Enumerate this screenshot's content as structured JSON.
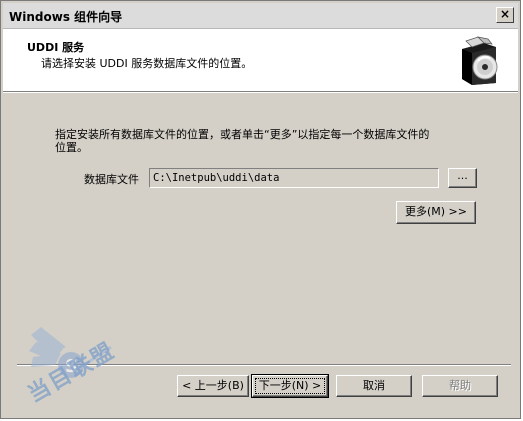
{
  "window": {
    "title": "Windows 组件向导",
    "close_label": "×"
  },
  "header": {
    "title": "UDDI 服务",
    "subtitle": "请选择安装 UDDI 服务数据库文件的位置。",
    "icon": "package-disc-icon"
  },
  "body": {
    "description": "指定安装所有数据库文件的位置，或者单击“更多”以指定每一个数据库文件的位置。",
    "field_label": "数据库文件",
    "path_value": "C:\\Inetpub\\uddi\\data",
    "browse_label": "...",
    "more_label": "更多(M) >>"
  },
  "buttons": {
    "back": "< 上一步(B)",
    "next": "下一步(N) >",
    "cancel": "取消",
    "help": "帮助"
  },
  "watermark": {
    "text": "当目联盟",
    "url": "www.Byue.com"
  }
}
